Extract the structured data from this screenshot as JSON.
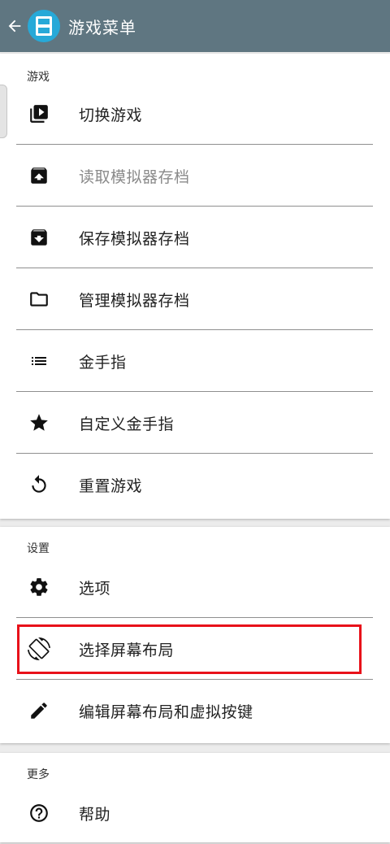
{
  "appbar": {
    "title": "游戏菜单",
    "back_icon": "arrow-back-icon",
    "logo_icon": "nintendo-ds-logo-icon",
    "color": "#5f7681",
    "logo_color": "#27a9d8"
  },
  "sections": {
    "game": {
      "header": "游戏",
      "items": [
        {
          "label": "切换游戏",
          "icon": "play-library-icon",
          "enabled": true
        },
        {
          "label": "读取模拟器存档",
          "icon": "load-archive-icon",
          "enabled": false
        },
        {
          "label": "保存模拟器存档",
          "icon": "save-archive-icon",
          "enabled": true
        },
        {
          "label": "管理模拟器存档",
          "icon": "folder-icon",
          "enabled": true
        },
        {
          "label": "金手指",
          "icon": "list-icon",
          "enabled": true
        },
        {
          "label": "自定义金手指",
          "icon": "star-icon",
          "enabled": true
        },
        {
          "label": "重置游戏",
          "icon": "restart-icon",
          "enabled": true
        }
      ]
    },
    "settings": {
      "header": "设置",
      "items": [
        {
          "label": "选项",
          "icon": "gear-icon",
          "enabled": true
        },
        {
          "label": "选择屏幕布局",
          "icon": "screen-rotation-icon",
          "enabled": true,
          "highlighted": true
        },
        {
          "label": "编辑屏幕布局和虚拟按键",
          "icon": "pencil-icon",
          "enabled": true
        }
      ]
    },
    "more": {
      "header": "更多",
      "items": [
        {
          "label": "帮助",
          "icon": "help-circle-icon",
          "enabled": true
        }
      ]
    }
  },
  "highlight_color": "#e8111a"
}
